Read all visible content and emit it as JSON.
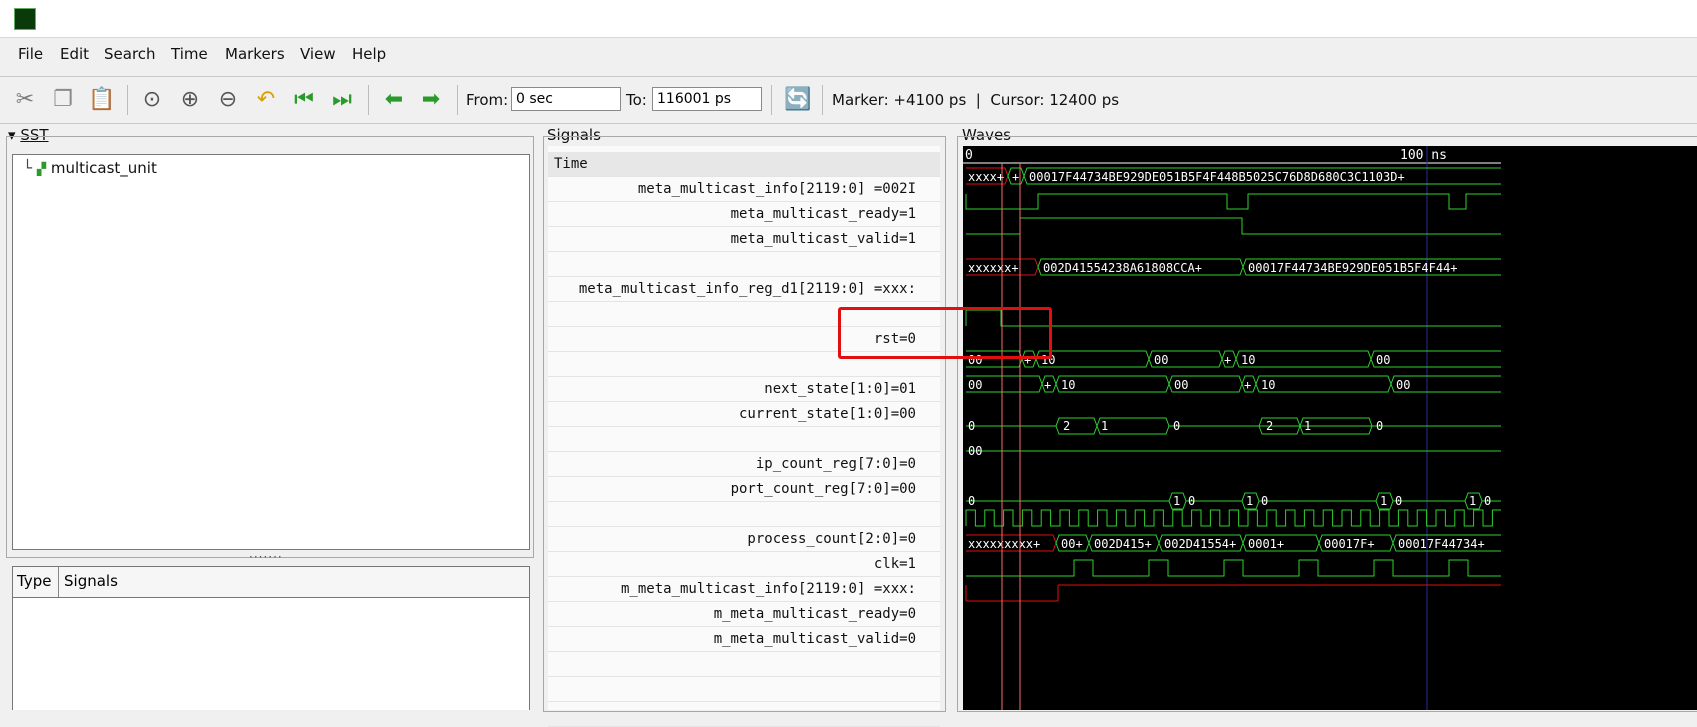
{
  "menu": [
    "File",
    "Edit",
    "Search",
    "Time",
    "Markers",
    "View",
    "Help"
  ],
  "toolbar": {
    "from_label": "From:",
    "from_value": "0 sec",
    "to_label": "To:",
    "to_value": "116001 ps",
    "marker_text": "Marker: +4100 ps  |  Cursor: 12400 ps"
  },
  "sst": {
    "title": "SST",
    "root": "multicast_unit",
    "dots": "·······"
  },
  "type_panel": {
    "type_col": "Type",
    "signals_col": "Signals"
  },
  "signals_panel": {
    "title": "Signals",
    "time_label": "Time",
    "rows": [
      {
        "text": "meta_multicast_info[2119:0] =002I"
      },
      {
        "text": "meta_multicast_ready=1"
      },
      {
        "text": "meta_multicast_valid=1"
      },
      {
        "text": ""
      },
      {
        "text": "meta_multicast_info_reg_d1[2119:0] =xxx:"
      },
      {
        "text": ""
      },
      {
        "text": "rst=0"
      },
      {
        "text": ""
      },
      {
        "text": "next_state[1:0]=01"
      },
      {
        "text": "current_state[1:0]=00"
      },
      {
        "text": ""
      },
      {
        "text": "ip_count_reg[7:0]=0"
      },
      {
        "text": "port_count_reg[7:0]=00"
      },
      {
        "text": ""
      },
      {
        "text": "process_count[2:0]=0"
      },
      {
        "text": "clk=1"
      },
      {
        "text": "m_meta_multicast_info[2119:0] =xxx:"
      },
      {
        "text": "m_meta_multicast_ready=0"
      },
      {
        "text": "m_meta_multicast_valid=0"
      },
      {
        "text": ""
      },
      {
        "text": ""
      },
      {
        "text": ""
      }
    ]
  },
  "waves": {
    "title": "Waves",
    "ruler": {
      "t0": "0",
      "t100": "100 ns"
    },
    "labels": {
      "info_a": "xxxx+",
      "info_b": "+",
      "info_c": "00017F44734BE929DE051B5F4F448B5025C76D8D680C3C1103D+",
      "reg_a": "xxxxxx+",
      "reg_b": "002D41554238A61808CCA+",
      "reg_c": "00017F44734BE929DE051B5F4F44+",
      "ns_00a": "00",
      "ns_p1": "+",
      "ns_10a": "10",
      "ns_00b": "00",
      "ns_p2": "+",
      "ns_10b": "10",
      "ns_00c": "00",
      "cs_00a": "00",
      "cs_p1": "+",
      "cs_10a": "10",
      "cs_00b": "00",
      "cs_p2": "+",
      "cs_10b": "10",
      "cs_00c": "00",
      "ip_0a": "0",
      "ip_2a": "2",
      "ip_1a": "1",
      "ip_0b": "0",
      "ip_2b": "2",
      "ip_1b": "1",
      "ip_0c": "0",
      "port_00": "00",
      "pc_0": "0",
      "pc_1a": "1",
      "pc_0a": "0",
      "pc_1b": "1",
      "pc_0b": "0",
      "pc_1c": "1",
      "pc_0c": "0",
      "pc_1d": "1",
      "pc_0d": "0",
      "m_a": "xxxxxxxxx+",
      "m_b": "00+",
      "m_c": "002D415+",
      "m_d": "002D41554+",
      "m_e": "0001+",
      "m_f": "00017F+",
      "m_g": "00017F44734+"
    }
  }
}
